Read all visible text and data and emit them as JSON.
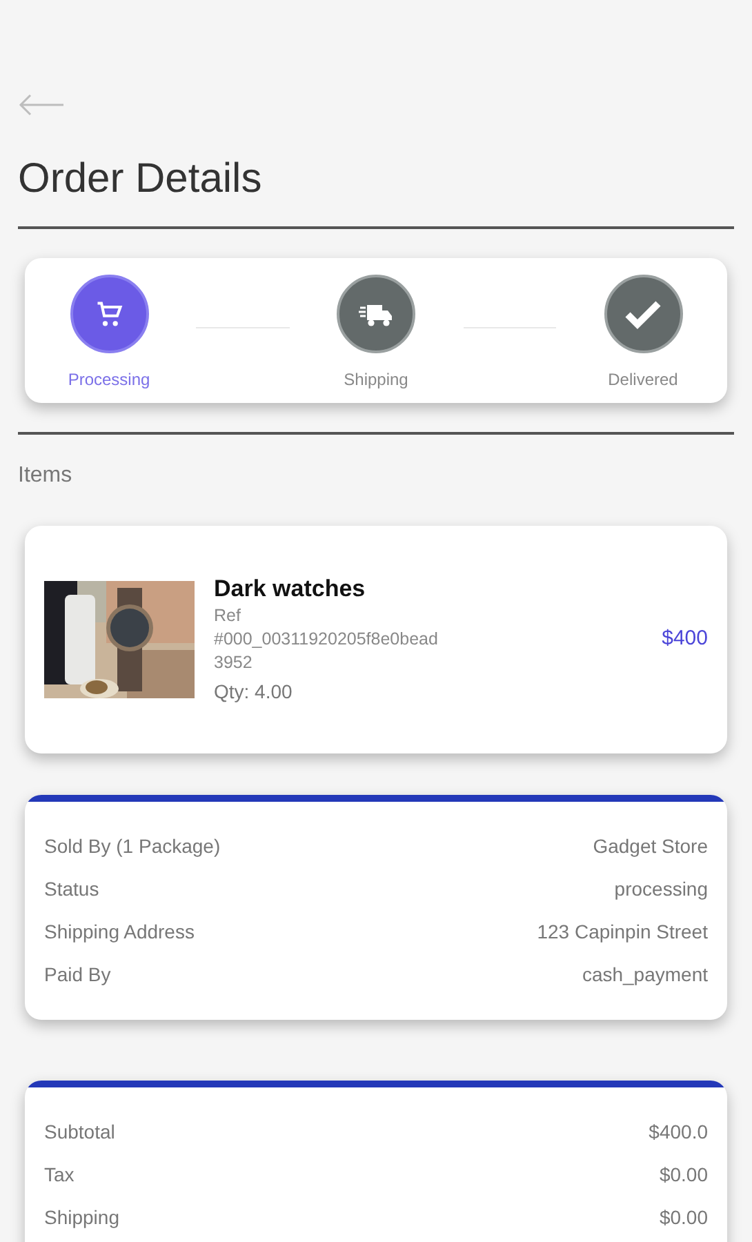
{
  "header": {
    "title": "Order Details"
  },
  "steps": [
    {
      "kind": "cart",
      "label": "Processing",
      "selected": true
    },
    {
      "kind": "truck",
      "label": "Shipping",
      "selected": false
    },
    {
      "kind": "check",
      "label": "Delivered",
      "selected": false
    }
  ],
  "items_heading": "Items",
  "items": [
    {
      "kind": "picture",
      "name": "Dark watches",
      "ref": [
        "Ref",
        "#000_00311920205f8e0bead",
        "3952"
      ],
      "qty": "Qty: 4.00",
      "price": "$400"
    }
  ],
  "details": [
    {
      "label": "Sold By (1 Package)",
      "value": "Gadget Store"
    },
    {
      "label": "Status",
      "value": "processing"
    },
    {
      "label": "Shipping Address",
      "value": "123 Capinpin Street"
    },
    {
      "label": "Paid By",
      "value": "cash_payment"
    }
  ],
  "totals": [
    {
      "label": "Subtotal",
      "value": "$400.0"
    },
    {
      "label": "Tax",
      "value": "$0.00"
    },
    {
      "label": "Shipping",
      "value": "$0.00"
    }
  ]
}
